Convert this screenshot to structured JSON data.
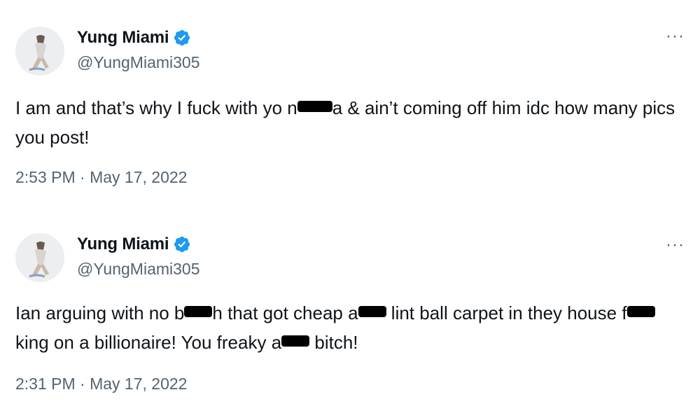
{
  "tweets": [
    {
      "display_name": "Yung Miami",
      "handle": "@YungMiami305",
      "more_label": "···",
      "text": {
        "part1": "I am and that’s why I fuck with yo n",
        "part2": "a & ain’t coming off him idc how many pics you post!"
      },
      "timestamp": "2:53 PM · May 17, 2022",
      "icons": {
        "verified": "verified-badge-icon",
        "avatar": "avatar"
      },
      "colors": {
        "verified": "#1d9bf0"
      }
    },
    {
      "display_name": "Yung Miami",
      "handle": "@YungMiami305",
      "more_label": "···",
      "text": {
        "part1": "Ian arguing with no b",
        "part2": "h that got cheap a",
        "part3": " lint ball carpet in they house f",
        "part4": "king on a billionaire! You freaky a",
        "part5": " bitch!"
      },
      "timestamp": "2:31 PM · May 17, 2022",
      "icons": {
        "verified": "verified-badge-icon",
        "avatar": "avatar"
      },
      "colors": {
        "verified": "#1d9bf0"
      }
    }
  ],
  "colors": {
    "text_primary": "#0f1419",
    "text_secondary": "#536471",
    "background": "#ffffff"
  }
}
